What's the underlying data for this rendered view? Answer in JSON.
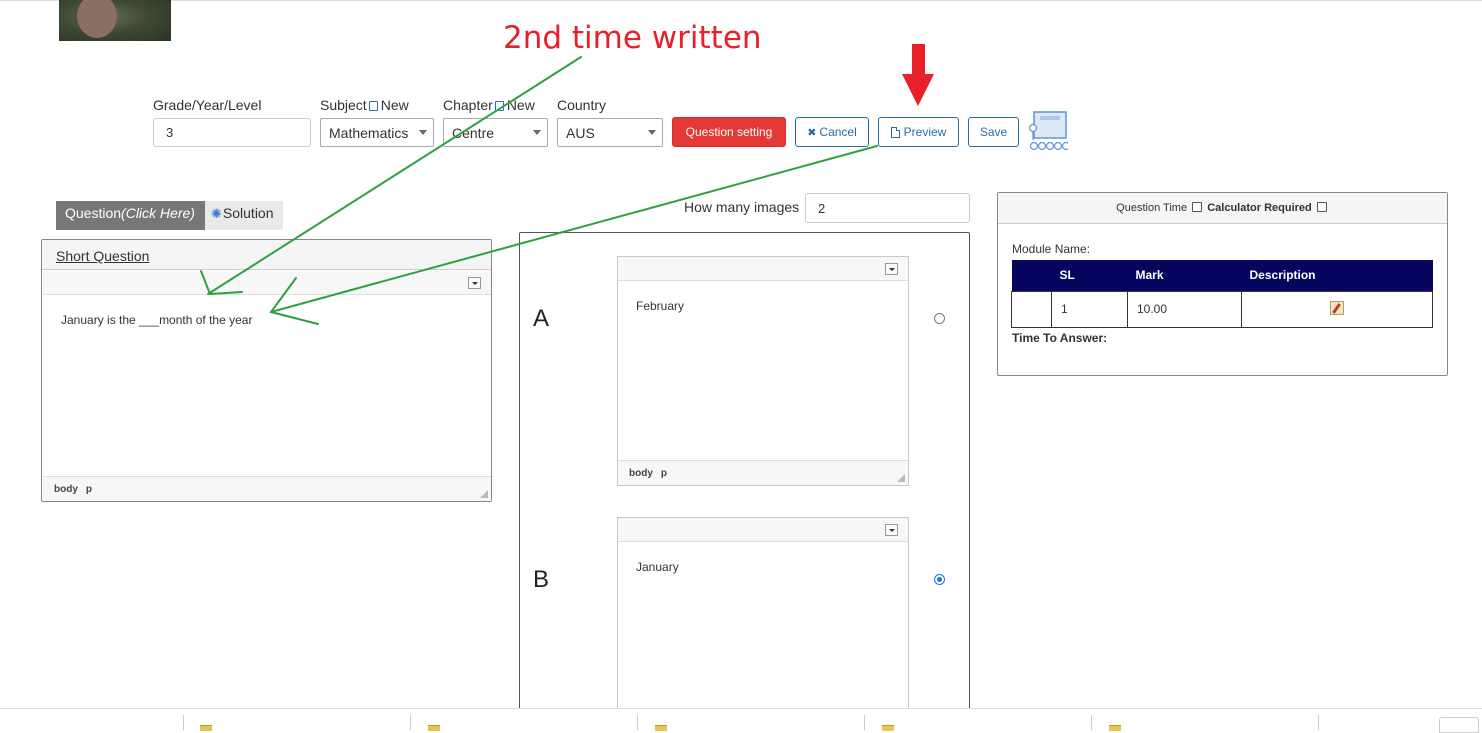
{
  "annotation": {
    "title": "2nd time written"
  },
  "form": {
    "grade": {
      "label": "Grade/Year/Level",
      "value": "3"
    },
    "subject": {
      "label": "Subject",
      "new_label": "New",
      "value": "Mathematics"
    },
    "chapter": {
      "label": "Chapter",
      "new_label": "New",
      "value": "Centre"
    },
    "country": {
      "label": "Country",
      "value": "AUS"
    }
  },
  "toolbar": {
    "question_setting": "Question setting",
    "cancel": "Cancel",
    "preview": "Preview",
    "save": "Save"
  },
  "tabs": {
    "question": "Question",
    "question_hint": "(Click Here)",
    "solution": "Solution"
  },
  "question_panel": {
    "title": "Short Question",
    "text": "January is the ___month of the year",
    "status": [
      "body",
      "p"
    ]
  },
  "images": {
    "label": "How many images",
    "value": "2"
  },
  "options": [
    {
      "letter": "A",
      "text": "February",
      "selected": false,
      "status": [
        "body",
        "p"
      ]
    },
    {
      "letter": "B",
      "text": "January",
      "selected": true
    }
  ],
  "right_panel": {
    "question_time": "Question Time",
    "calculator_required": "Calculator Required",
    "module_name": "Module Name:",
    "table": {
      "headers": [
        "",
        "SL",
        "Mark",
        "Description"
      ],
      "rows": [
        {
          "sl": "1",
          "mark": "10.00"
        }
      ]
    },
    "time_to_answer": "Time To Answer:"
  },
  "colors": {
    "accent_red": "#e53935",
    "link_blue": "#2d6ca2",
    "table_header": "#06065e",
    "annotation_green": "#2ea043",
    "annotation_red": "#e8202a"
  }
}
